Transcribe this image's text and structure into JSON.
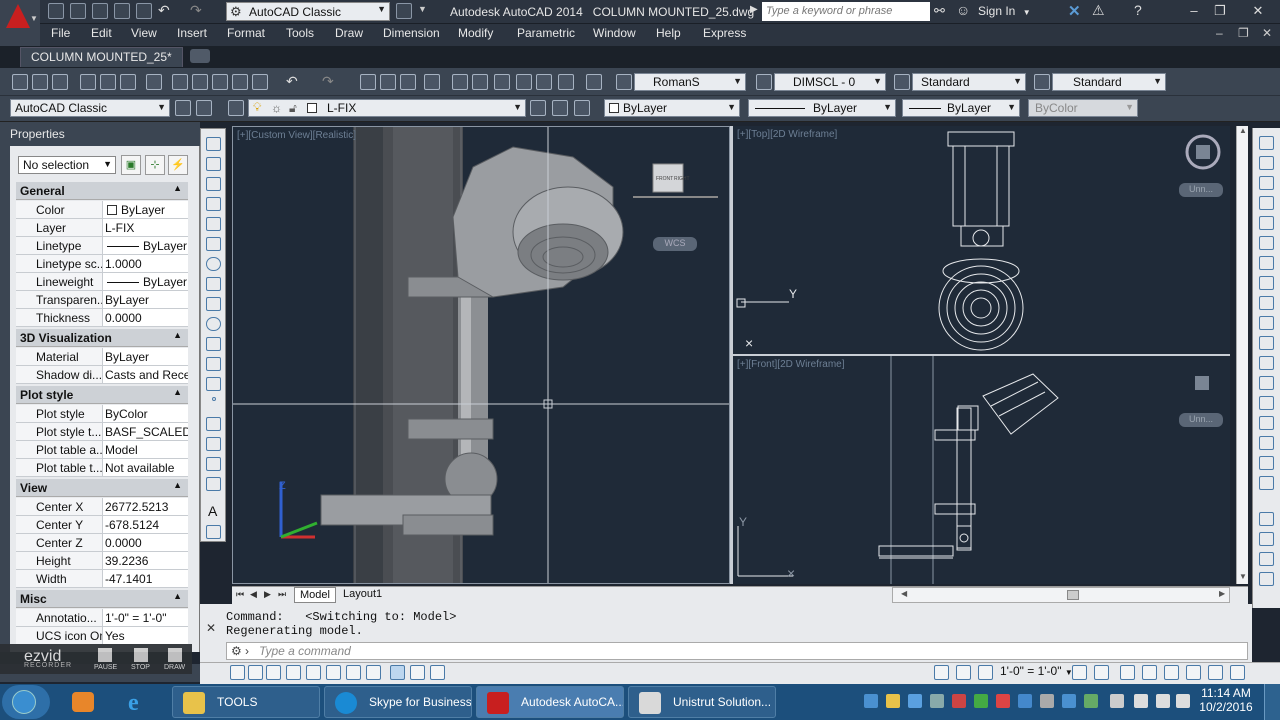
{
  "app": {
    "workspace": "AutoCAD Classic",
    "title": "Autodesk AutoCAD 2014",
    "file": "COLUMN MOUNTED_25.dwg",
    "search_placeholder": "Type a keyword or phrase",
    "signin": "Sign In"
  },
  "menu": [
    "File",
    "Edit",
    "View",
    "Insert",
    "Format",
    "Tools",
    "Draw",
    "Dimension",
    "Modify",
    "Parametric",
    "Window",
    "Help",
    "Express"
  ],
  "doc_tab": "COLUMN MOUNTED_25*",
  "toolbar1": {
    "text_style": "RomanS",
    "dim_style": "DIMSCL - 0",
    "table_style": "Standard",
    "multileader_style": "Standard"
  },
  "toolbar2": {
    "workspace": "AutoCAD Classic",
    "layer": "L-FIX",
    "color": "ByLayer",
    "linetype": "ByLayer",
    "lineweight": "ByLayer",
    "plotstyle": "ByColor"
  },
  "properties": {
    "title": "Properties",
    "selection": "No selection",
    "categories": {
      "general": "General",
      "viz": "3D Visualization",
      "plot": "Plot style",
      "view": "View",
      "misc": "Misc"
    },
    "general": [
      {
        "k": "Color",
        "v": "ByLayer"
      },
      {
        "k": "Layer",
        "v": "L-FIX"
      },
      {
        "k": "Linetype",
        "v": "ByLayer"
      },
      {
        "k": "Linetype sc...",
        "v": "1.0000"
      },
      {
        "k": "Lineweight",
        "v": "ByLayer"
      },
      {
        "k": "Transparen...",
        "v": "ByLayer"
      },
      {
        "k": "Thickness",
        "v": "0.0000"
      }
    ],
    "viz": [
      {
        "k": "Material",
        "v": "ByLayer"
      },
      {
        "k": "Shadow di...",
        "v": "Casts and Rece..."
      }
    ],
    "plot": [
      {
        "k": "Plot style",
        "v": "ByColor"
      },
      {
        "k": "Plot style t...",
        "v": "BASF_SCALED_..."
      },
      {
        "k": "Plot table a...",
        "v": "Model"
      },
      {
        "k": "Plot table t...",
        "v": "Not available"
      }
    ],
    "view": [
      {
        "k": "Center X",
        "v": "26772.5213"
      },
      {
        "k": "Center Y",
        "v": "-678.5124"
      },
      {
        "k": "Center Z",
        "v": "0.0000"
      },
      {
        "k": "Height",
        "v": "39.2236"
      },
      {
        "k": "Width",
        "v": "-47.1401"
      }
    ],
    "misc": [
      {
        "k": "Annotatio...",
        "v": "1'-0\" = 1'-0\""
      },
      {
        "k": "UCS icon On",
        "v": "Yes"
      }
    ]
  },
  "viewports": {
    "v1": "[+][Custom View][Realistic]",
    "v2": "[+][Top][2D Wireframe]",
    "v3": "[+][Front][2D Wireframe]",
    "wcs": "WCS",
    "cube_front": "FRONT",
    "cube_right": "RIGHT",
    "unnamed": "Unn..."
  },
  "layout_tabs": {
    "model": "Model",
    "layout1": "Layout1"
  },
  "command": {
    "line1": "Command:   <Switching to: Model>",
    "line2": "Regenerating model.",
    "placeholder": "Type a command"
  },
  "status": {
    "scale": "1'-0\" = 1'-0\""
  },
  "ezvid": {
    "logo": "ezvid",
    "sub": "RECORDER",
    "pause": "PAUSE",
    "stop": "STOP",
    "draw": "DRAW"
  },
  "taskbar": {
    "items": [
      {
        "label": "TOOLS"
      },
      {
        "label": "Skype for Business"
      },
      {
        "label": "Autodesk AutoCA..."
      },
      {
        "label": "Unistrut Solution..."
      }
    ],
    "time": "11:14 AM",
    "date": "10/2/2016"
  },
  "colors": {
    "autocad_red": "#c81f1f",
    "viewport_bg": "#1f2a38",
    "taskbar": "#1c4f7c"
  }
}
